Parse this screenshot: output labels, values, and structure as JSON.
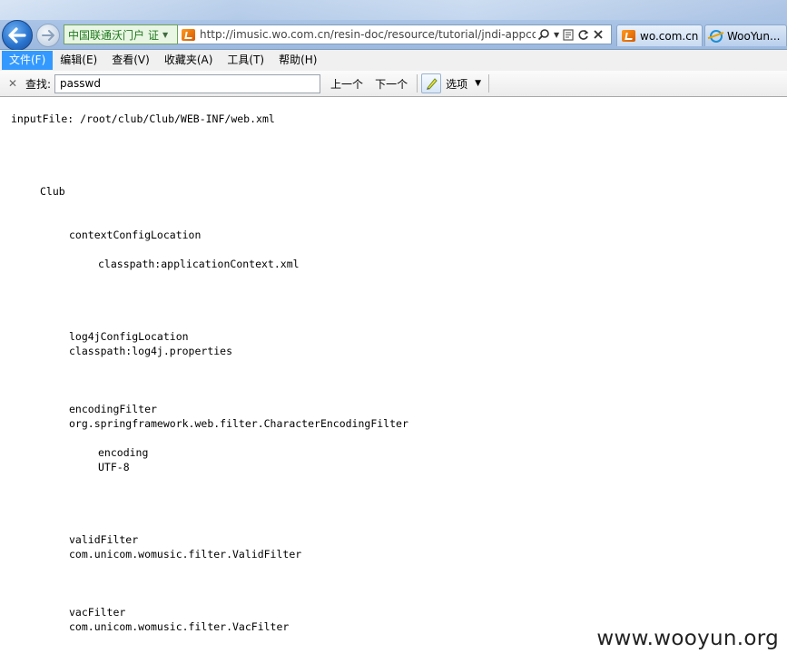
{
  "browser": {
    "site_identity": "中国联通沃门户",
    "site_cert_badge": "证",
    "url": "http://imusic.wo.com.cn/resin-doc/resource/tutorial/jndi-appconfig/...",
    "tabs": [
      {
        "label": "wo.com.cn"
      },
      {
        "label": "WooYun..."
      }
    ]
  },
  "menu": {
    "items": [
      "文件(F)",
      "编辑(E)",
      "查看(V)",
      "收藏夹(A)",
      "工具(T)",
      "帮助(H)"
    ],
    "active_index": 0
  },
  "findbar": {
    "label": "查找:",
    "query": "passwd",
    "prev_label": "上一个",
    "next_label": "下一个",
    "options_label": "选项"
  },
  "content": {
    "lines": [
      "inputFile: /root/club/Club/WEB-INF/web.xml",
      "Club",
      "contextConfigLocation",
      "classpath:applicationContext.xml",
      "log4jConfigLocation",
      "classpath:log4j.properties",
      "encodingFilter",
      "org.springframework.web.filter.CharacterEncodingFilter",
      "encoding",
      "UTF-8",
      "validFilter",
      "com.unicom.womusic.filter.ValidFilter",
      "vacFilter",
      "com.unicom.womusic.filter.VacFilter"
    ]
  },
  "watermark": "www.wooyun.org",
  "colors": {
    "menu_active": "#3399ff",
    "chrome_blue": "#a9c3e6"
  }
}
